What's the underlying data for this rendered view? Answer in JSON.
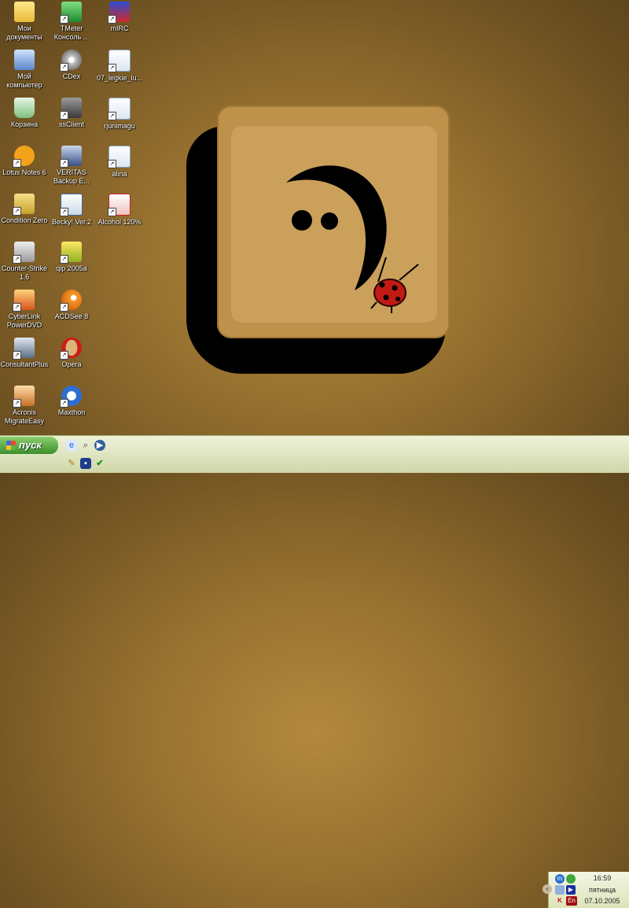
{
  "desktop": {
    "icons": [
      {
        "label": "Мои документы",
        "icon": "my-documents-icon"
      },
      {
        "label": "Мой компьютер",
        "icon": "my-computer-icon"
      },
      {
        "label": "Корзина",
        "icon": "recycle-bin-icon"
      },
      {
        "label": "Lotus Notes 6",
        "icon": "lotus-notes-icon"
      },
      {
        "label": "Condition Zero",
        "icon": "condition-zero-icon"
      },
      {
        "label": "Counter-Strike 1.6",
        "icon": "counter-strike-icon"
      },
      {
        "label": "CyberLink PowerDVD",
        "icon": "powerdvd-icon"
      },
      {
        "label": "ConsultantPlus",
        "icon": "consultantplus-icon"
      },
      {
        "label": "Acronis MigrateEasy",
        "icon": "acronis-icon"
      },
      {
        "label": "TMeter Консоль ...",
        "icon": "tmeter-icon"
      },
      {
        "label": "CDex",
        "icon": "cdex-icon"
      },
      {
        "label": "ssClient",
        "icon": "ssclient-icon"
      },
      {
        "label": "VERITAS Backup E...",
        "icon": "veritas-icon"
      },
      {
        "label": "Becky! Ver.2",
        "icon": "becky-icon"
      },
      {
        "label": "qip 2005a",
        "icon": "qip-icon"
      },
      {
        "label": "ACDSee 8",
        "icon": "acdsee-icon"
      },
      {
        "label": "Opera",
        "icon": "opera-icon"
      },
      {
        "label": "Maxthon",
        "icon": "maxthon-icon"
      },
      {
        "label": "mIRC",
        "icon": "mirc-icon"
      },
      {
        "label": "07_legkie_lu...",
        "icon": "audio-file-icon"
      },
      {
        "label": "rjunimagu",
        "icon": "audio-file-icon"
      },
      {
        "label": "alina",
        "icon": "audio-file-icon"
      },
      {
        "label": "Alcohol 120%",
        "icon": "alcohol-icon"
      }
    ]
  },
  "taskbar": {
    "start_label": "пуск",
    "quick_launch": [
      "ie-icon",
      "search-icon",
      "media-player-icon",
      "tool-icon",
      "save-icon",
      "check-icon"
    ]
  },
  "tray": {
    "time": "16:59",
    "day": "пятница",
    "date": "07.10.2005",
    "language": "En",
    "icons": [
      "maxthon-tray-icon",
      "qip-tray-icon",
      "network-icon",
      "media-tray-icon",
      "kaspersky-icon",
      "language-icon"
    ]
  },
  "colors": {
    "wallpaper": "#96702f",
    "taskbar": "#dfe5bd",
    "start_button": "#3b8f2e"
  }
}
